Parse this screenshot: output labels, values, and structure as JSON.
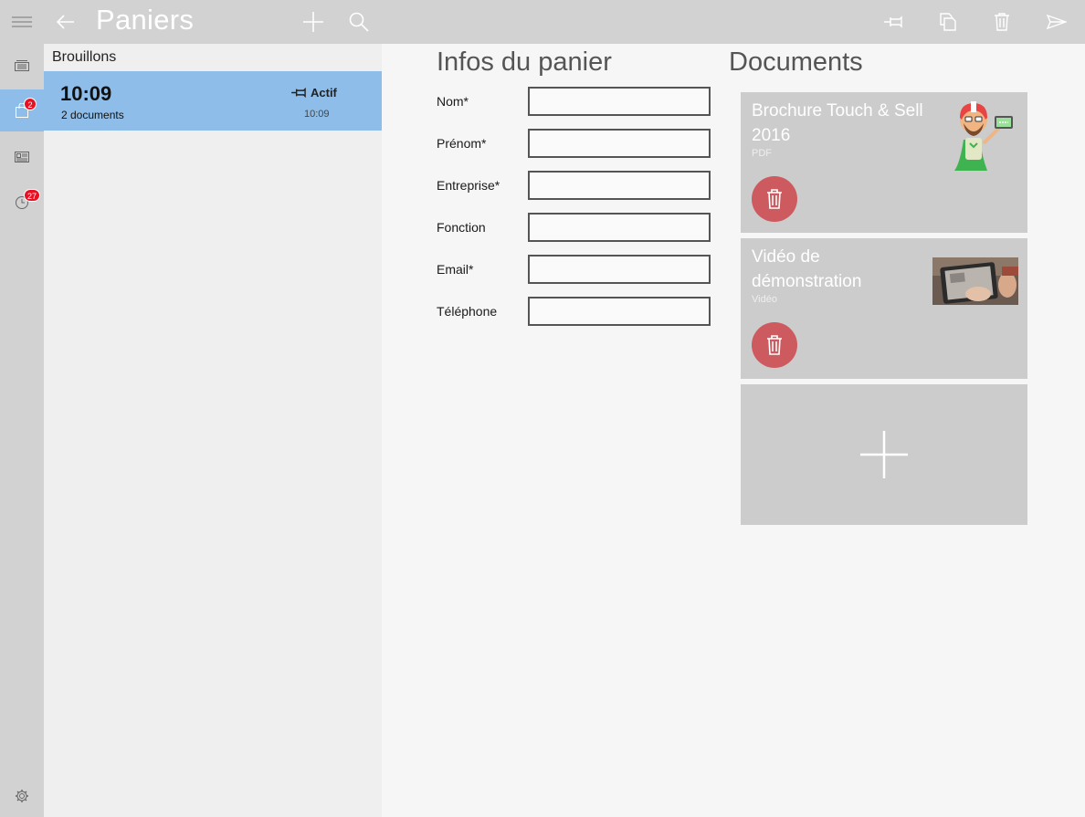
{
  "rail": {
    "items": [
      {
        "icon": "hamburger-menu-icon"
      },
      {
        "icon": "catalog-icon"
      },
      {
        "icon": "shopping-bag-icon",
        "badge": "2",
        "active": true
      },
      {
        "icon": "news-icon"
      },
      {
        "icon": "history-clock-icon",
        "badge": "27"
      },
      {
        "icon": "settings-gear-icon"
      }
    ]
  },
  "topbar": {
    "title": "Paniers",
    "actions": [
      "back-arrow-icon",
      "add-icon",
      "search-icon",
      "pin-icon",
      "copy-icon",
      "delete-icon",
      "send-icon"
    ]
  },
  "list": {
    "group_title": "Brouillons",
    "items": [
      {
        "time": "10:09",
        "subtitle": "2 documents",
        "status": "Actif",
        "timestamp": "10:09"
      }
    ]
  },
  "form": {
    "title": "Infos du panier",
    "fields": [
      {
        "label": "Nom*",
        "value": ""
      },
      {
        "label": "Prénom*",
        "value": ""
      },
      {
        "label": "Entreprise*",
        "value": ""
      },
      {
        "label": "Fonction",
        "value": ""
      },
      {
        "label": "Email*",
        "value": ""
      },
      {
        "label": "Téléphone",
        "value": ""
      }
    ]
  },
  "documents": {
    "title": "Documents",
    "items": [
      {
        "title": "Brochure Touch & Sell 2016",
        "type": "PDF"
      },
      {
        "title": "Vidéo de démonstration",
        "type": "Vidéo"
      }
    ]
  },
  "colors": {
    "accent": "#8dbde8",
    "rail": "#d2d2d2",
    "delete": "#cd5a5e",
    "badge": "#e81123"
  }
}
